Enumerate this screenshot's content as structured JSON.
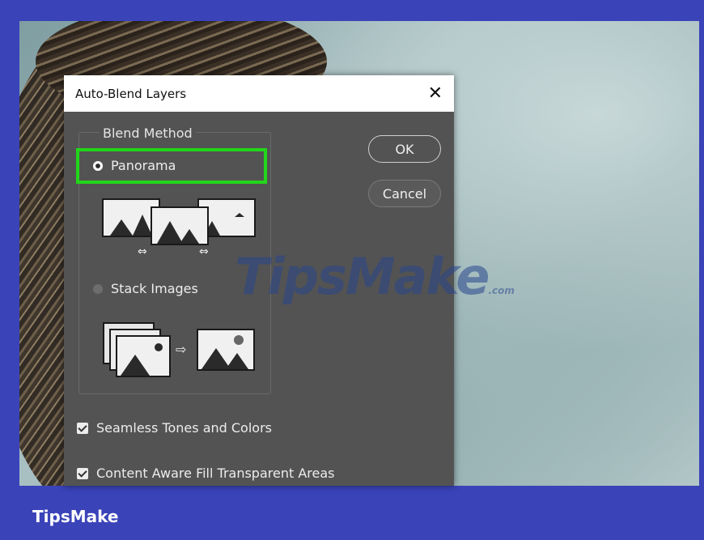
{
  "dialog": {
    "title": "Auto-Blend Layers",
    "close_glyph": "✕",
    "blend_method_label": "Blend Method",
    "options": [
      {
        "label": "Panorama",
        "selected": true
      },
      {
        "label": "Stack Images",
        "selected": false
      }
    ],
    "ok_label": "OK",
    "cancel_label": "Cancel",
    "checkboxes": [
      {
        "label": "Seamless Tones and Colors",
        "checked": true
      },
      {
        "label": "Content Aware Fill Transparent Areas",
        "checked": true
      }
    ]
  },
  "watermark": {
    "main": "TipsMake",
    "suffix": ".com"
  },
  "footer": {
    "brand": "TipsMake"
  },
  "colors": {
    "frame": "#3a43b8",
    "highlight": "#22d61a",
    "dialog_bg": "#535353"
  },
  "icons": [
    "close-icon",
    "panorama-illustration",
    "stack-images-illustration",
    "radio-selected",
    "radio-unselected",
    "checkbox-checked"
  ]
}
